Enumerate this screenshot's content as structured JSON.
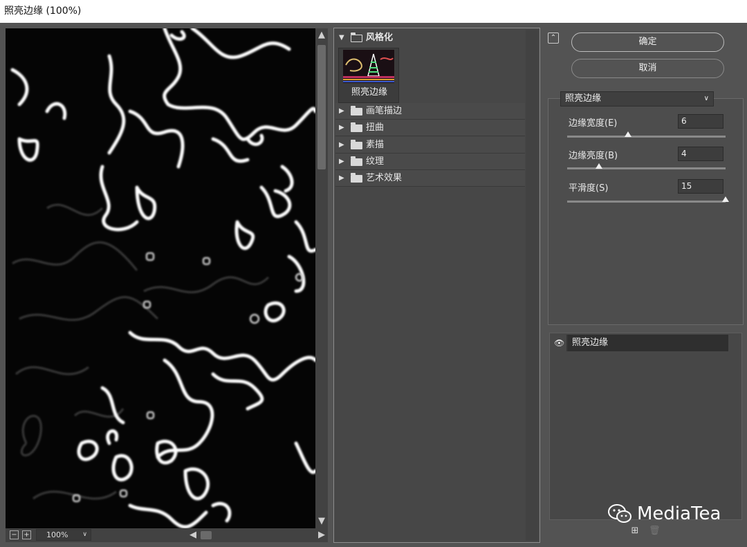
{
  "window": {
    "title": "照亮边缘 (100%)"
  },
  "preview": {
    "zoom": "100%",
    "zoom_out_icon": "minus-box-icon",
    "zoom_in_icon": "plus-box-icon"
  },
  "gallery": {
    "categories": [
      {
        "label": "风格化",
        "expanded": true
      },
      {
        "label": "画笔描边",
        "expanded": false
      },
      {
        "label": "扭曲",
        "expanded": false
      },
      {
        "label": "素描",
        "expanded": false
      },
      {
        "label": "纹理",
        "expanded": false
      },
      {
        "label": "艺术效果",
        "expanded": false
      }
    ],
    "selected_thumb_label": "照亮边缘"
  },
  "buttons": {
    "ok": "确定",
    "cancel": "取消"
  },
  "settings": {
    "filter_name": "照亮边缘",
    "params": [
      {
        "label": "边缘宽度(E)",
        "label_display": "边缘宽度(E)",
        "value": "6",
        "min": 1,
        "max": 14
      },
      {
        "label": "边缘亮度(B)",
        "label_display": "边缘亮度(B)",
        "value": "4",
        "min": 0,
        "max": 20
      },
      {
        "label": "平滑度(S)",
        "label_display": "平滑度(S)",
        "value": "15",
        "min": 1,
        "max": 15
      }
    ]
  },
  "layers": {
    "items": [
      {
        "label": "照亮边缘",
        "visible": true
      }
    ]
  },
  "watermark": {
    "text": "MediaTea"
  }
}
